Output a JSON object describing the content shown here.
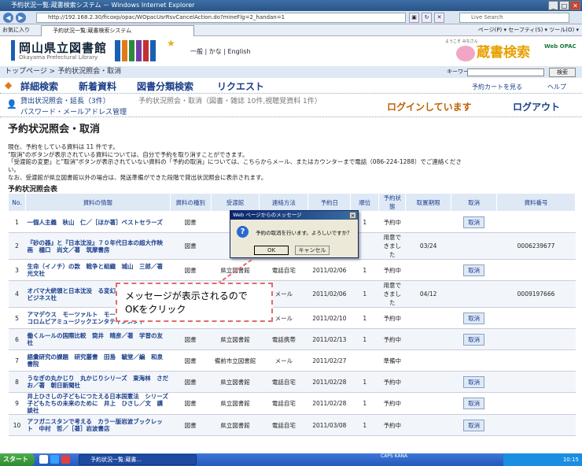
{
  "browser": {
    "window_title": "予約状況一覧:蔵書検索システム － Windows Internet Explorer",
    "url": "http://192.168.2.30/ficoxp/opac/WOpacUsrRsvCancelAction.do?mineFlg=2_handan=1",
    "search_placeholder": "Live Search",
    "favorites_label": "お気に入り",
    "tab_title": "予約状況一覧:蔵書検索システム",
    "tab_tools": "ページ(P) ▾  セーフティ(S) ▾  ツール(O) ▾"
  },
  "site": {
    "library_name": "岡山県立図書館",
    "library_name_en": "Okayama Prefectural Library",
    "lang_links": "一般 | かな | English",
    "system_name": "蔵書検索",
    "web_opac": "Web OPAC",
    "welcome": "ようこそ\nみなさん"
  },
  "breadcrumb": {
    "text": "トップページ > 予約状況照会・取消",
    "keyword_label": "キーワード",
    "search_button": "検索"
  },
  "main_nav": {
    "items": [
      "詳細検索",
      "新着資料",
      "図書分類検索",
      "リクエスト"
    ],
    "cart_link": "予約カートを見る",
    "help_link": "ヘルプ"
  },
  "user_nav": {
    "loan_link": "貸出状況照会・延長（3件）",
    "reserve_link": "予約状況照会・取消（図書・雑誌 10件,視聴覚資料 1件）",
    "password_link": "パスワード・メールアドレス管理",
    "login_status": "ログインしています",
    "logout": "ログアウト"
  },
  "page": {
    "title": "予約状況照会・取消",
    "info1": "現在、予約をしている資料は 11 件です。",
    "info2": "\"取消\"のボタンが表示されている資料については、自分で予約を取り消すことができます。",
    "info3": "「受渡館の変更」と\"取消\"ボタンが表示されていない資料の「予約の取消」については、こちらからメール、またはカウンターまで電話（086-224-1288）でご連絡くださ",
    "info4": "い。",
    "info5": "なお、受渡館が県立図書館以外の場合は、発送準備ができた段階で貸出状況照会に表示されます。",
    "table_title": "予約状況照会表"
  },
  "table": {
    "headers": [
      "No.",
      "資料の情報",
      "資料の種別",
      "受渡館",
      "連絡方法",
      "予約日",
      "順位",
      "予約状態",
      "取置期限",
      "取消",
      "資料番号"
    ],
    "rows": [
      {
        "no": "1",
        "title": "一個人主義　秋山　仁／［ほか著］ベストセラーズ",
        "type": "図書",
        "lib": "県立",
        "contact": "",
        "date": "",
        "rank": "1",
        "status": "予約中",
        "limit": "",
        "cancel": "取消",
        "num": ""
      },
      {
        "no": "2",
        "title": "『砂の器』と『日本沈没』７０年代日本の超大作映画　樋口　尚文／著　筑摩書房",
        "type": "図書",
        "lib": "県立",
        "contact": "",
        "date": "",
        "rank": "",
        "status": "用意できました",
        "limit": "03/24",
        "cancel": "",
        "num": "0006239677"
      },
      {
        "no": "3",
        "title": "生命（イノチ）の款　戦争と組織　城山　三郎／著　光文社",
        "type": "図書",
        "lib": "県立図書館",
        "contact": "電話自宅",
        "date": "2011/02/06",
        "rank": "1",
        "status": "予約中",
        "limit": "",
        "cancel": "取消",
        "num": ""
      },
      {
        "no": "4",
        "title": "オバマ大統領と日本沈没　る変幻と外交戦略　古森　ビジネス社",
        "type": "図書",
        "lib": "",
        "contact": "メール",
        "date": "2011/02/06",
        "rank": "1",
        "status": "用意できました",
        "limit": "04/12",
        "cancel": "",
        "num": "0009197666"
      },
      {
        "no": "5",
        "title": "アマデウス　モーツァルト　モーツァルト／作曲　コロムビアミュージックエンタテインメント",
        "type": "",
        "lib": "",
        "contact": "メール",
        "date": "2011/02/10",
        "rank": "1",
        "status": "予約中",
        "limit": "",
        "cancel": "取消",
        "num": ""
      },
      {
        "no": "6",
        "title": "働くルールの国際比較　筒井　晴彦／著　学習の友社",
        "type": "図書",
        "lib": "県立図書館",
        "contact": "電話携帯",
        "date": "2011/02/13",
        "rank": "1",
        "status": "予約中",
        "limit": "",
        "cancel": "取消",
        "num": ""
      },
      {
        "no": "7",
        "title": "語彙研究の課題　研究叢書　田島　毓堂／編　和泉書院",
        "type": "図書",
        "lib": "備前市立図書館",
        "contact": "メール",
        "date": "2011/02/27",
        "rank": "",
        "status": "準備中",
        "limit": "",
        "cancel": "",
        "num": ""
      },
      {
        "no": "8",
        "title": "うなぎの丸かじり　丸かじりシリーズ　東海林　さだお／著　朝日新聞社",
        "type": "図書",
        "lib": "県立図書館",
        "contact": "電話自宅",
        "date": "2011/02/28",
        "rank": "1",
        "status": "予約中",
        "limit": "",
        "cancel": "取消",
        "num": ""
      },
      {
        "no": "9",
        "title": "井上ひさしの子どもにつたえる日本国憲法　シリーズ子どもたちの未来のために　井上　ひさし／文　講談社",
        "type": "図書",
        "lib": "県立図書館",
        "contact": "電話自宅",
        "date": "2011/02/28",
        "rank": "1",
        "status": "予約中",
        "limit": "",
        "cancel": "取消",
        "num": ""
      },
      {
        "no": "10",
        "title": "アフガニスタンで考える　カラー版岩波ブックレット　中村　哲／［著］岩波書店",
        "type": "図書",
        "lib": "県立図書館",
        "contact": "電話自宅",
        "date": "2011/03/08",
        "rank": "1",
        "status": "予約中",
        "limit": "",
        "cancel": "取消",
        "num": ""
      }
    ]
  },
  "dialog": {
    "title": "Web ページからのメッセージ",
    "message": "予約の取消を行います。よろしいですか？",
    "ok": "OK",
    "cancel": "キャンセル",
    "close": "✕"
  },
  "callout": {
    "line1": "メッセージが表示されるので",
    "line2": "OKをクリック"
  },
  "taskbar": {
    "start": "スタート",
    "task": "予約状況一覧:蔵書...",
    "clock": "10:15",
    "mid": "CAPS\nKANA"
  },
  "colors": {
    "accent": "#1a3e8a",
    "highlight": "#e26b6b",
    "nav_bg": "#dfe9f6"
  }
}
